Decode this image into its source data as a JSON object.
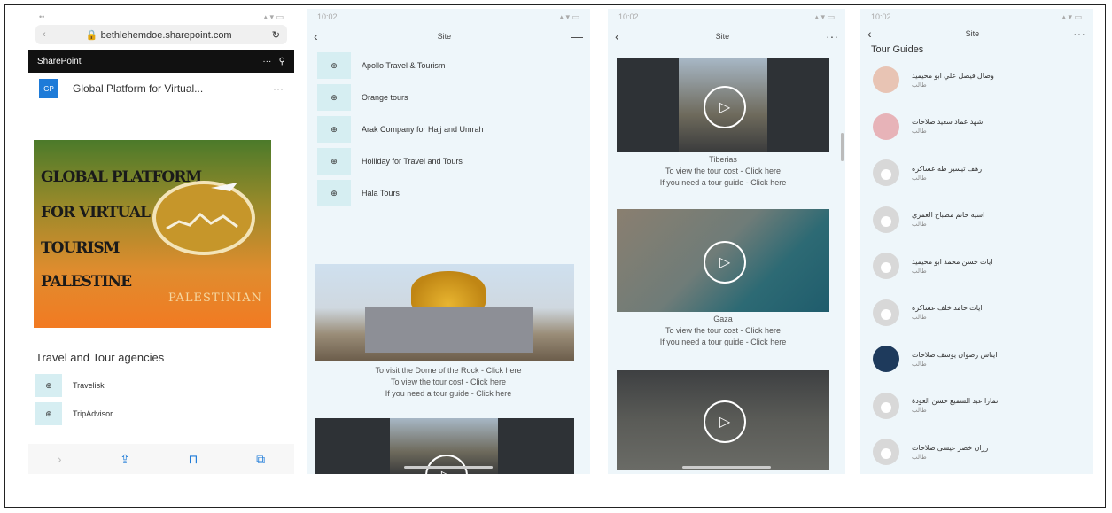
{
  "phone1": {
    "url": "bethlehemdoe.sharepoint.com",
    "app_name": "SharePoint",
    "site_badge": "GP",
    "site_title": "Global Platform for Virtual...",
    "logo_lines": [
      "GLOBAL PLATFORM",
      "FOR VIRTUAL",
      "TOURISM",
      "PALESTINE"
    ],
    "logo_sub": "PALESTINIAN",
    "section_title": "Travel and Tour agencies",
    "agencies": [
      {
        "label": "Travelisk"
      },
      {
        "label": "TripAdvisor"
      }
    ]
  },
  "phone2": {
    "time": "10:02",
    "nav_title": "Site",
    "agencies": [
      {
        "label": "Apollo Travel & Tourism"
      },
      {
        "label": "Orange tours"
      },
      {
        "label": "Arak Company for Hajj and Umrah"
      },
      {
        "label": "Holliday for Travel and Tours"
      },
      {
        "label": "Hala Tours"
      }
    ],
    "captions": [
      "To visit the Dome of the Rock - Click here",
      "To view the tour cost - Click here",
      "If you need a tour guide - Click here"
    ]
  },
  "phone3": {
    "time": "10:02",
    "nav_title": "Site",
    "videos": [
      {
        "place": "Tiberias",
        "cost": "To view the tour cost - Click here",
        "guide": "If you need a tour guide - Click here"
      },
      {
        "place": "Gaza",
        "cost": "To view the tour cost - Click here",
        "guide": "If you need a tour guide - Click here"
      }
    ]
  },
  "phone4": {
    "time": "10:02",
    "nav_title": "Site",
    "section_title": "Tour Guides",
    "guides": [
      {
        "name": "وصال فيصل علي ابو محيميد",
        "role": "طالب"
      },
      {
        "name": "شهد عماد سعيد صلاحات",
        "role": "طالب"
      },
      {
        "name": "رهف تيسير طه عساكره",
        "role": "طالب"
      },
      {
        "name": "اسيه حاتم مصباح العمري",
        "role": "طالب"
      },
      {
        "name": "ايات حسن محمد ابو محيميد",
        "role": "طالب"
      },
      {
        "name": "ايات حامد خلف عساكره",
        "role": "طالب"
      },
      {
        "name": "ايناس رضوان يوسف صلاحات",
        "role": "طالب"
      },
      {
        "name": "تمارا عبد السميع حسن العودة",
        "role": "طالب"
      },
      {
        "name": "رزان خضر عيسى صلاحات",
        "role": "طالب"
      }
    ]
  },
  "colors": {
    "accent": "#1e7bd8",
    "globe_tile": "#d6eef2",
    "bg_light": "#eef6fa"
  }
}
